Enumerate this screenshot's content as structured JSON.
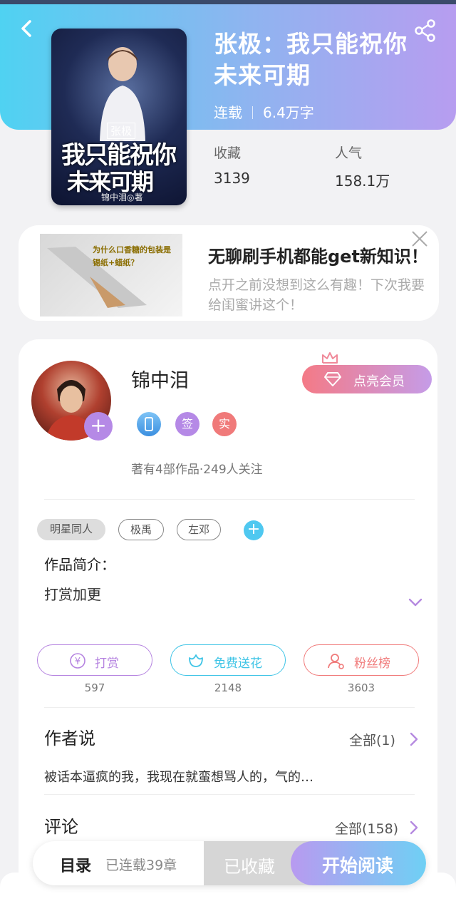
{
  "book": {
    "title": "张极：我只能祝你未来可期",
    "status": "连载",
    "word_count": "6.4万字",
    "cover": {
      "bracket": "张极",
      "title_line1": "我只能祝你",
      "title_line2": "未来可期",
      "author_line": "锦中泪◎著"
    },
    "stats": {
      "favorites_label": "收藏",
      "favorites_value": "3139",
      "popularity_label": "人气",
      "popularity_value": "158.1万"
    }
  },
  "ad": {
    "title": "无聊刷手机都能get新知识！",
    "description": "点开之前没想到这么有趣！下次我要给闺蜜讲这个！",
    "image_text": "为什么口香糖的包装是锡纸+蜡纸？"
  },
  "author": {
    "name": "锦中泪",
    "vip_label": "点亮会员",
    "badges": [
      "签",
      "实"
    ],
    "works_info": "著有4部作品·249人关注"
  },
  "tags": [
    "明星同人",
    "极禹",
    "左邓"
  ],
  "intro": {
    "label": "作品简介：",
    "text": "打赏加更"
  },
  "actions": [
    {
      "label": "打赏",
      "count": "597",
      "color": "#b583e0"
    },
    {
      "label": "免费送花",
      "count": "2148",
      "color": "#3ec4e6"
    },
    {
      "label": "粉丝榜",
      "count": "3603",
      "color": "#f07a7a"
    }
  ],
  "author_says": {
    "title": "作者说",
    "more": "全部(1)",
    "text": "被话本逼疯的我，我现在就蛮想骂人的，气的…"
  },
  "comments": {
    "title": "评论",
    "more": "全部(158)"
  },
  "bottom_bar": {
    "toc_label": "目录",
    "toc_status": "已连载39章",
    "collect_label": "已收藏",
    "read_label": "开始阅读"
  },
  "colors": {
    "hero_start": "#4fd2f2",
    "hero_end": "#b79df0",
    "accent_purple": "#b589e6"
  }
}
